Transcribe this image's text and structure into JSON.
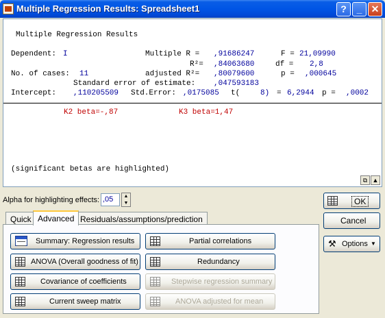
{
  "window": {
    "title": "Multiple Regression Results: Spreadsheet1",
    "help_glyph": "?",
    "minimize_glyph": "_",
    "close_glyph": "✕"
  },
  "results": {
    "heading": "Multiple Regression Results",
    "line1_label": "Dependent:",
    "line1_dep": "I",
    "line1_mr_label": "Multiple R =",
    "line1_mr": ",91686247",
    "line1_f_label": "F =",
    "line1_f": "21,09990",
    "line2_r2_label": "R²=",
    "line2_r2": ",84063680",
    "line2_df_label": "df =",
    "line2_df": "2,8",
    "line3_label": "No. of cases:",
    "line3_cases": "11",
    "line3_adj_label": "adjusted R²=",
    "line3_adj": ",80079600",
    "line3_p_label": "p =",
    "line3_p": ",000645",
    "line4_label": "Standard error of estimate:",
    "line4_se": ",047593183",
    "line5_label": "Intercept:",
    "line5_int": ",110205509",
    "line5_se_label": "Std.Error:",
    "line5_se": ",0175085",
    "line5_t_label": "t(",
    "line5_t_df": "8)",
    "line5_t_eq": "=",
    "line5_t": "6,2944",
    "line5_p_label": "p =",
    "line5_p": ",0002",
    "beta1": "K2 beta=-,87",
    "beta2": "K3 beta=1,47",
    "note": "(significant betas are highlighted)"
  },
  "alpha": {
    "label": "Alpha for highlighting effects:",
    "value": ",05"
  },
  "tabs": [
    "Quick",
    "Advanced",
    "Residuals/assumptions/prediction"
  ],
  "active_tab": "Advanced",
  "buttons": {
    "summary": "Summary:  Regression results",
    "partial": "Partial correlations",
    "anova": "ANOVA (Overall goodness of fit)",
    "redundancy": "Redundancy",
    "covariance": "Covariance of coefficients",
    "stepwise": "Stepwise regression summary",
    "sweep": "Current sweep matrix",
    "anova_adj": "ANOVA adjusted for mean"
  },
  "side": {
    "ok": "OK",
    "cancel": "Cancel",
    "options": "Options"
  }
}
